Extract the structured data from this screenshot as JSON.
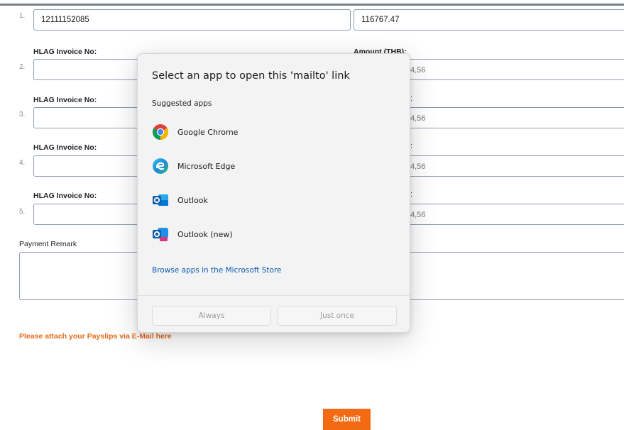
{
  "form": {
    "rows": [
      {
        "num": "1.",
        "invoice": "12111152085",
        "amount": "116767.47"
      },
      {
        "num": "2.",
        "invoice_label": "HLAG Invoice No:",
        "amount_label": "Amount (THB):",
        "amount_hint": "4,56"
      },
      {
        "num": "3.",
        "invoice_label": "HLAG Invoice No:",
        "amount_hint": "4,56"
      },
      {
        "num": "4.",
        "invoice_label": "HLAG Invoice No:",
        "amount_hint": "4,56"
      },
      {
        "num": "5.",
        "invoice_label": "HLAG Invoice No:",
        "amount_hint": "4,56"
      }
    ],
    "colon": ":",
    "payment_remark_label": "Payment Remark",
    "attach_note": "Please attach your Payslips via E-Mail here",
    "submit_label": "Submit"
  },
  "dialog": {
    "title": "Select an app to open this 'mailto' link",
    "suggested_label": "Suggested apps",
    "apps": [
      {
        "name": "Google Chrome",
        "icon": "chrome-icon"
      },
      {
        "name": "Microsoft Edge",
        "icon": "edge-icon"
      },
      {
        "name": "Outlook",
        "icon": "outlook-icon"
      },
      {
        "name": "Outlook (new)",
        "icon": "outlook-new-icon"
      }
    ],
    "store_link": "Browse apps in the Microsoft Store",
    "always_label": "Always",
    "just_once_label": "Just once"
  },
  "colors": {
    "accent_orange": "#f26a12",
    "link_blue": "#0a5bb5",
    "field_border": "#8e9bb0"
  }
}
